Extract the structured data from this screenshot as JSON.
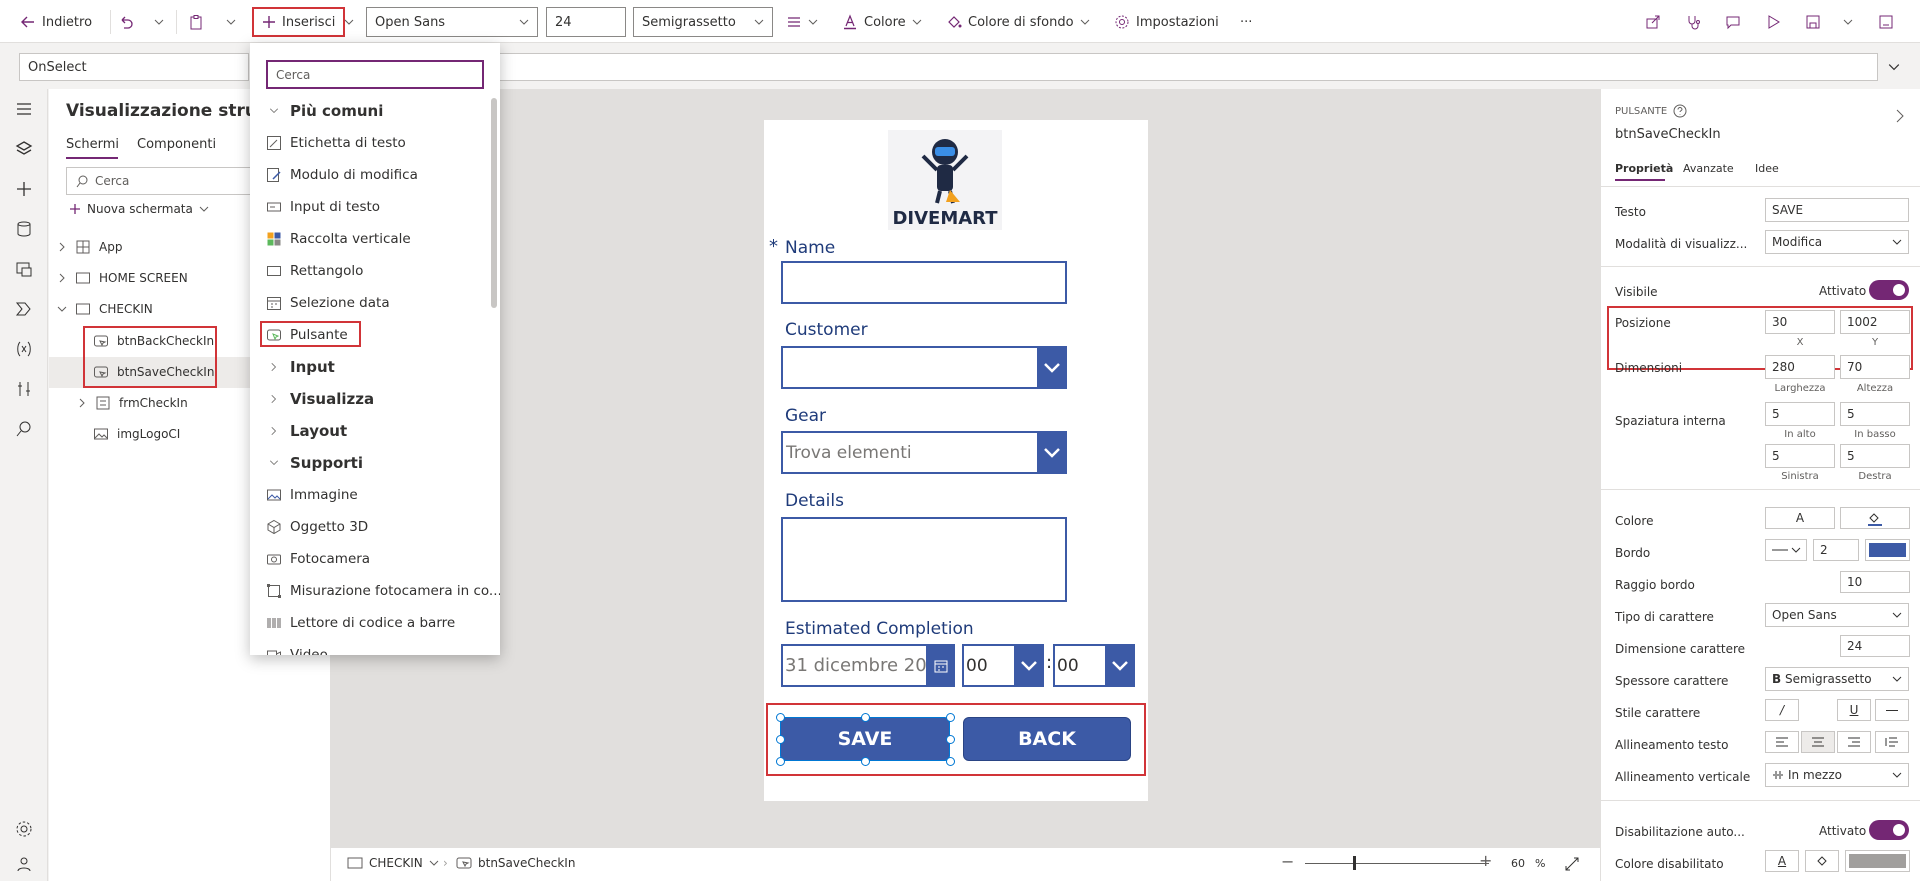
{
  "toolbar": {
    "back_label": "Indietro",
    "insert_label": "Inserisci",
    "font": "Open Sans",
    "font_size": "24",
    "font_weight": "Semigrassetto",
    "color_label": "Colore",
    "bgcolor_label": "Colore di sfondo",
    "settings_label": "Impostazioni",
    "more": "···"
  },
  "formula": {
    "property": "OnSelect"
  },
  "tree": {
    "title": "Visualizzazione struttu",
    "tabs": [
      "Schermi",
      "Componenti"
    ],
    "search_placeholder": "Cerca",
    "new_screen": "Nuova schermata",
    "items": [
      {
        "label": "App"
      },
      {
        "label": "HOME SCREEN"
      },
      {
        "label": "CHECKIN"
      },
      {
        "label": "btnBackCheckIn"
      },
      {
        "label": "btnSaveCheckIn"
      },
      {
        "label": "frmCheckIn"
      },
      {
        "label": "imgLogoCI"
      }
    ]
  },
  "insert_menu": {
    "search_placeholder": "Cerca",
    "rows": [
      {
        "label": "Più comuni",
        "kind": "cat-open"
      },
      {
        "label": "Etichetta di testo",
        "icon": "text-label-icon"
      },
      {
        "label": "Modulo di modifica",
        "icon": "edit-form-icon"
      },
      {
        "label": "Input di testo",
        "icon": "text-input-icon"
      },
      {
        "label": "Raccolta verticale",
        "icon": "gallery-icon"
      },
      {
        "label": "Rettangolo",
        "icon": "rectangle-icon"
      },
      {
        "label": "Selezione data",
        "icon": "calendar-icon"
      },
      {
        "label": "Pulsante",
        "icon": "button-icon"
      },
      {
        "label": "Input",
        "kind": "cat"
      },
      {
        "label": "Visualizza",
        "kind": "cat"
      },
      {
        "label": "Layout",
        "kind": "cat"
      },
      {
        "label": "Supporti",
        "kind": "cat-open"
      },
      {
        "label": "Immagine",
        "icon": "image-icon"
      },
      {
        "label": "Oggetto 3D",
        "icon": "cube-icon"
      },
      {
        "label": "Fotocamera",
        "icon": "camera-icon"
      },
      {
        "label": "Misurazione fotocamera in co...",
        "icon": "measure-icon"
      },
      {
        "label": "Lettore di codice a barre",
        "icon": "barcode-icon"
      },
      {
        "label": "Video",
        "icon": "video-icon"
      }
    ]
  },
  "screen": {
    "logo_text": "DIVEMART",
    "required_mark": "*",
    "name_label": "Name",
    "customer_label": "Customer",
    "gear_label": "Gear",
    "gear_placeholder": "Trova elementi",
    "details_label": "Details",
    "estimated_label": "Estimated Completion",
    "date_value": "31 dicembre 20",
    "hour_value": "00",
    "minute_value": "00",
    "time_sep": ":",
    "save_label": "SAVE",
    "back_label": "BACK"
  },
  "status": {
    "screen": "CHECKIN",
    "control": "btnSaveCheckIn",
    "zoom": "60",
    "zoom_unit": "%"
  },
  "props": {
    "type_label": "PULSANTE",
    "control_name": "btnSaveCheckIn",
    "tabs": [
      "Proprietà",
      "Avanzate",
      "Idee"
    ],
    "rows": {
      "testo": {
        "label": "Testo",
        "value": "SAVE"
      },
      "modalita": {
        "label": "Modalità di visualizz...",
        "value": "Modifica"
      },
      "visibile": {
        "label": "Visibile",
        "value": "Attivato"
      },
      "posizione": {
        "label": "Posizione",
        "x": "30",
        "y": "1002",
        "x_sub": "X",
        "y_sub": "Y"
      },
      "dimensioni": {
        "label": "Dimensioni",
        "w": "280",
        "h": "70",
        "w_sub": "Larghezza",
        "h_sub": "Altezza"
      },
      "spaziatura": {
        "label": "Spaziatura interna",
        "top": "5",
        "bottom": "5",
        "left": "5",
        "right": "5",
        "top_sub": "In alto",
        "bottom_sub": "In basso",
        "left_sub": "Sinistra",
        "right_sub": "Destra"
      },
      "colore": {
        "label": "Colore",
        "glyph": "A"
      },
      "bordo": {
        "label": "Bordo",
        "value": "2"
      },
      "raggio": {
        "label": "Raggio bordo",
        "value": "10"
      },
      "tipo_car": {
        "label": "Tipo di carattere",
        "value": "Open Sans"
      },
      "dim_car": {
        "label": "Dimensione carattere",
        "value": "24"
      },
      "spessore": {
        "label": "Spessore carattere",
        "bold_glyph": "B",
        "value": "Semigrassetto"
      },
      "stile": {
        "label": "Stile carattere",
        "italic": "/",
        "underline": "U",
        "strike": "—"
      },
      "allin_testo": {
        "label": "Allineamento testo"
      },
      "allin_vert": {
        "label": "Allineamento verticale",
        "value": "In mezzo"
      },
      "disab_auto": {
        "label": "Disabilitazione auto...",
        "value": "Attivato"
      },
      "colore_disab": {
        "label": "Colore disabilitato",
        "glyph": "A"
      }
    }
  },
  "colors": {
    "accent": "#3c5aa6",
    "purple": "#742774",
    "highlight_red": "#d13438"
  }
}
